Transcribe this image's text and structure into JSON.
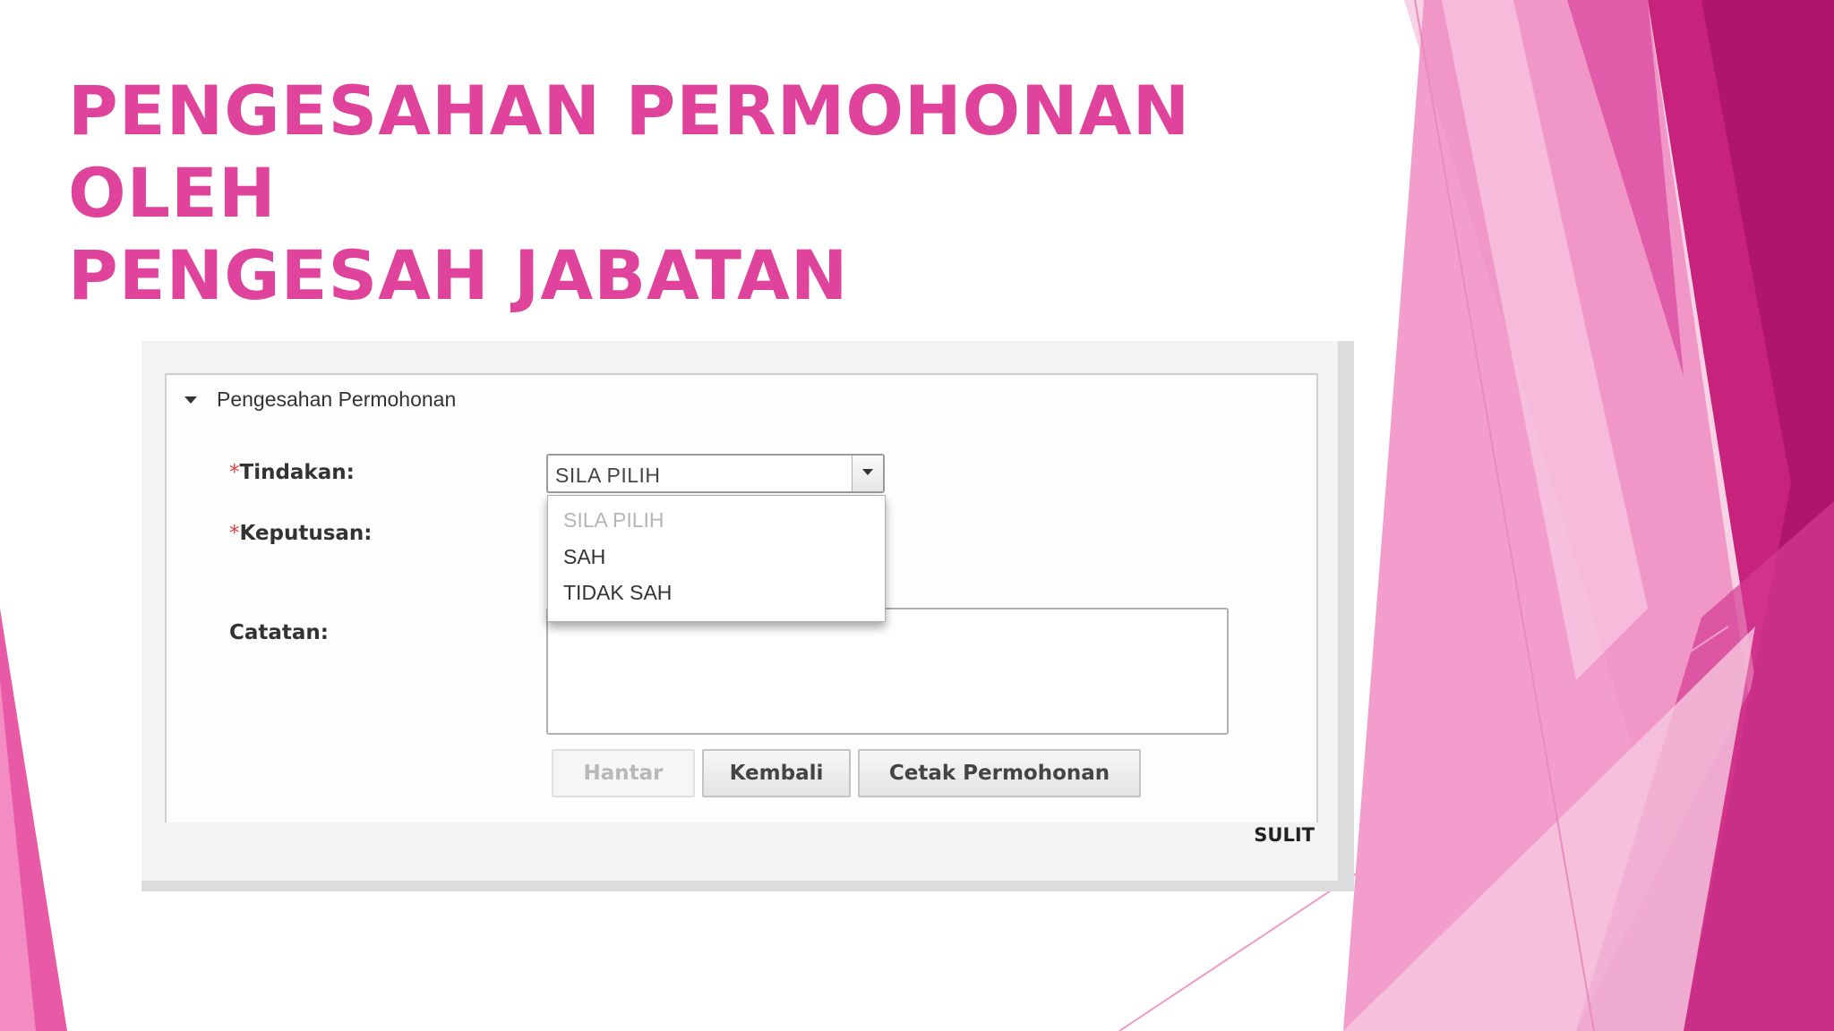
{
  "slide": {
    "title_line1": "PENGESAHAN PERMOHONAN OLEH",
    "title_line2": "PENGESAH JABATAN"
  },
  "panel": {
    "title": "Pengesahan Permohonan",
    "required_mark": "*",
    "labels": {
      "tindakan": "Tindakan:",
      "keputusan": "Keputusan:",
      "catatan": "Catatan:"
    },
    "tindakan_select": {
      "selected": "SILA PILIH",
      "options": [
        "SILA PILIH",
        "SAH",
        "TIDAK SAH"
      ]
    },
    "catatan_value": "",
    "buttons": {
      "hantar": "Hantar",
      "kembali": "Kembali",
      "cetak": "Cetak Permohonan"
    },
    "classification": "SULIT"
  },
  "colors": {
    "title_pink": "#e0439b",
    "accent_magenta": "#b5156f"
  }
}
